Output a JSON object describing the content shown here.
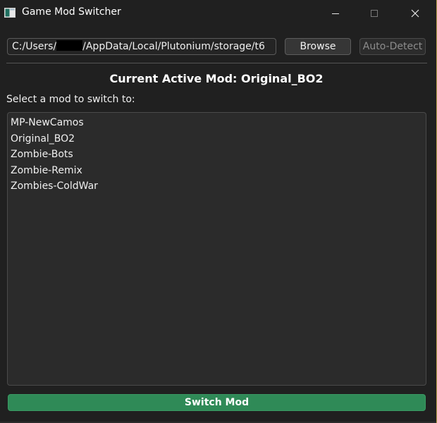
{
  "window": {
    "title": "Game Mod Switcher",
    "controls": {
      "minimize": "minimize-icon",
      "maximize": "maximize-icon",
      "close": "close-icon"
    }
  },
  "path_row": {
    "path_prefix": "C:/Users/",
    "path_suffix": "/AppData/Local/Plutonium/storage/t6",
    "browse_label": "Browse",
    "auto_detect_label": "Auto-Detect"
  },
  "status": {
    "current_active_mod": "Current Active Mod: Original_BO2"
  },
  "mods": {
    "prompt": "Select a mod to switch to:",
    "items": [
      {
        "label": "MP-NewCamos"
      },
      {
        "label": "Original_BO2"
      },
      {
        "label": "Zombie-Bots"
      },
      {
        "label": "Zombie-Remix"
      },
      {
        "label": "Zombies-ColdWar"
      }
    ]
  },
  "actions": {
    "switch_label": "Switch Mod"
  },
  "colors": {
    "background": "#202020",
    "switch_button": "#2f8a57",
    "text": "#f0f0f0",
    "disabled_text": "#8c8c8c"
  }
}
